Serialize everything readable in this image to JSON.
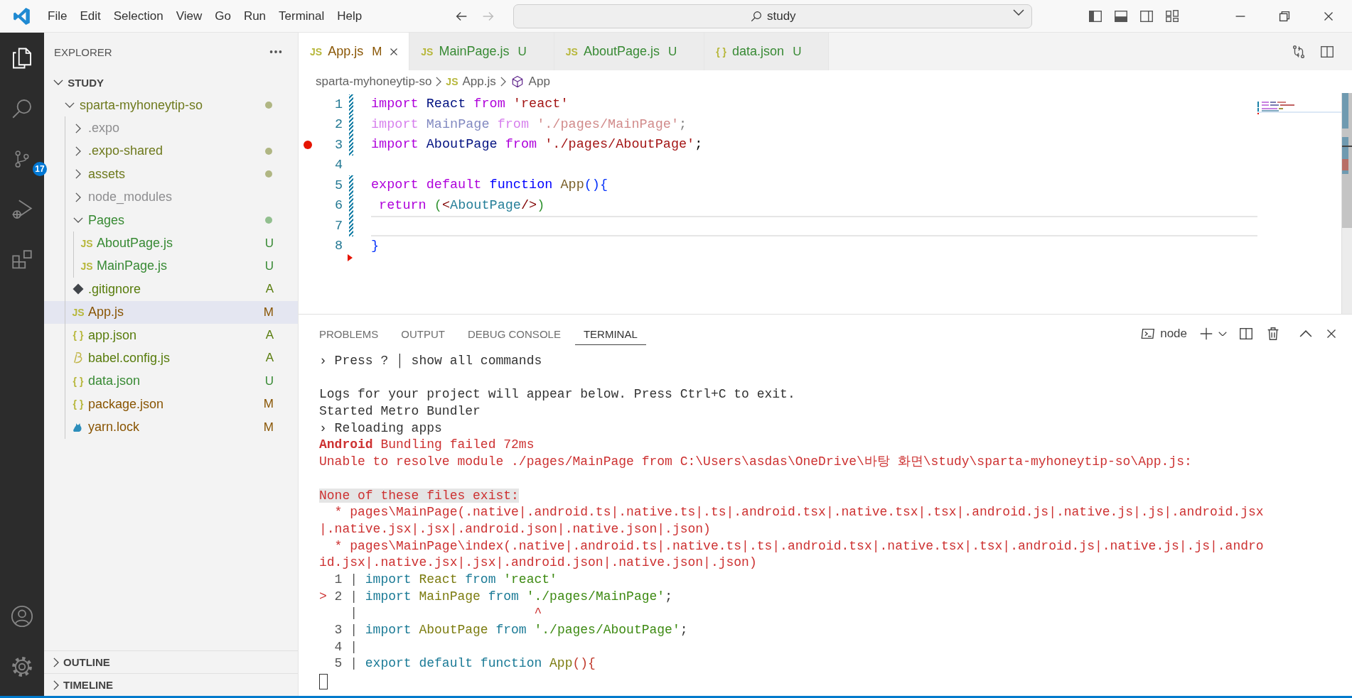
{
  "menu": [
    "File",
    "Edit",
    "Selection",
    "View",
    "Go",
    "Run",
    "Terminal",
    "Help"
  ],
  "search": {
    "value": "study"
  },
  "activity_bar": [
    {
      "kind": "explorer",
      "selected": true
    },
    {
      "kind": "search",
      "selected": false
    },
    {
      "kind": "source-control",
      "selected": false,
      "badge": "17"
    },
    {
      "kind": "run-debug",
      "selected": false
    },
    {
      "kind": "extensions",
      "selected": false
    }
  ],
  "activity_bottom": [
    {
      "kind": "account"
    },
    {
      "kind": "settings"
    }
  ],
  "sidebar": {
    "title": "EXPLORER",
    "root": {
      "label": "STUDY",
      "expanded": true
    },
    "tree": [
      {
        "label": "sparta-myhoneytip-so",
        "kind": "folder",
        "color": "#6f7a1e",
        "dot": true,
        "expanded": true,
        "selected": false,
        "children": [
          {
            "label": ".expo",
            "kind": "folder",
            "color": "#8e8e90",
            "dot": false,
            "expanded": false,
            "selected": false
          },
          {
            "label": ".expo-shared",
            "kind": "folder",
            "color": "#6f7a1e",
            "dot": true,
            "expanded": false,
            "selected": false
          },
          {
            "label": "assets",
            "kind": "folder",
            "color": "#6f7a1e",
            "dot": true,
            "expanded": false,
            "selected": false
          },
          {
            "label": "node_modules",
            "kind": "folder",
            "color": "#8e8e90",
            "dot": false,
            "expanded": false,
            "selected": false
          },
          {
            "label": "Pages",
            "kind": "folder",
            "color": "#388a34",
            "dot": true,
            "expanded": true,
            "selected": false,
            "children": [
              {
                "label": "AboutPage.js",
                "kind": "file",
                "icon": {
                  "kind": "text",
                  "text": "JS"
                },
                "color": "#388a34",
                "status": "U",
                "selected": false
              },
              {
                "label": "MainPage.js",
                "kind": "file",
                "icon": {
                  "kind": "text",
                  "text": "JS"
                },
                "color": "#388a34",
                "status": "U",
                "selected": false
              }
            ]
          },
          {
            "label": ".gitignore",
            "kind": "file",
            "icon": {
              "kind": "git"
            },
            "color": "#587c0c",
            "status": "A",
            "selected": false
          },
          {
            "label": "App.js",
            "kind": "file",
            "icon": {
              "kind": "text",
              "text": "JS"
            },
            "color": "#895503",
            "status": "M",
            "selected": true
          },
          {
            "label": "app.json",
            "kind": "file",
            "icon": {
              "kind": "text",
              "text": "{ }"
            },
            "color": "#587c0c",
            "status": "A",
            "selected": false
          },
          {
            "label": "babel.config.js",
            "kind": "file",
            "icon": {
              "kind": "babel"
            },
            "color": "#587c0c",
            "status": "A",
            "selected": false
          },
          {
            "label": "data.json",
            "kind": "file",
            "icon": {
              "kind": "text",
              "text": "{ }"
            },
            "color": "#388a34",
            "status": "U",
            "selected": false
          },
          {
            "label": "package.json",
            "kind": "file",
            "icon": {
              "kind": "text",
              "text": "{ }"
            },
            "color": "#895503",
            "status": "M",
            "selected": false
          },
          {
            "label": "yarn.lock",
            "kind": "file",
            "icon": {
              "kind": "yarn"
            },
            "color": "#895503",
            "status": "M",
            "selected": false
          }
        ]
      }
    ],
    "sections": [
      {
        "label": "OUTLINE",
        "expanded": false
      },
      {
        "label": "TIMELINE",
        "expanded": false
      }
    ]
  },
  "tabs": [
    {
      "label": "App.js",
      "icon": {
        "kind": "text",
        "text": "JS"
      },
      "status": "M",
      "color": "#895503",
      "selected": true
    },
    {
      "label": "MainPage.js",
      "icon": {
        "kind": "text",
        "text": "JS"
      },
      "status": "U",
      "color": "#388a34",
      "selected": false
    },
    {
      "label": "AboutPage.js",
      "icon": {
        "kind": "text",
        "text": "JS"
      },
      "status": "U",
      "color": "#388a34",
      "selected": false
    },
    {
      "label": "data.json",
      "icon": {
        "kind": "text",
        "text": "{ }"
      },
      "status": "U",
      "color": "#388a34",
      "selected": false
    }
  ],
  "breadcrumb": [
    {
      "label": "sparta-myhoneytip-so"
    },
    {
      "label": "App.js",
      "icon": {
        "kind": "text",
        "text": "JS"
      }
    },
    {
      "label": "App",
      "icon": {
        "kind": "symbol"
      }
    }
  ],
  "editor": {
    "lines": [
      {
        "number": "1",
        "changed": true,
        "deleted": false,
        "breakpoint": false,
        "current": false,
        "faded": false,
        "tokens": [
          {
            "t": "import ",
            "kind": "keyword"
          },
          {
            "t": "React ",
            "kind": "variable"
          },
          {
            "t": "from ",
            "kind": "keyword"
          },
          {
            "t": "'react'",
            "kind": "string"
          }
        ]
      },
      {
        "number": "2",
        "changed": true,
        "deleted": false,
        "breakpoint": false,
        "current": false,
        "faded": true,
        "tokens": [
          {
            "t": "import ",
            "kind": "keyword"
          },
          {
            "t": "MainPage ",
            "kind": "variable"
          },
          {
            "t": "from ",
            "kind": "keyword"
          },
          {
            "t": "'./pages/MainPage'",
            "kind": "string"
          },
          {
            "t": ";",
            "kind": "punct"
          }
        ]
      },
      {
        "number": "3",
        "changed": true,
        "deleted": false,
        "breakpoint": true,
        "current": false,
        "faded": false,
        "tokens": [
          {
            "t": "import ",
            "kind": "keyword"
          },
          {
            "t": "AboutPage ",
            "kind": "variable"
          },
          {
            "t": "from ",
            "kind": "keyword"
          },
          {
            "t": "'./pages/AboutPage'",
            "kind": "string"
          },
          {
            "t": ";",
            "kind": "punct"
          }
        ]
      },
      {
        "number": "4",
        "changed": false,
        "deleted": false,
        "breakpoint": false,
        "current": false
      },
      {
        "number": "5",
        "changed": true,
        "deleted": false,
        "breakpoint": false,
        "current": false,
        "faded": false,
        "tokens": [
          {
            "t": "export default ",
            "kind": "keyword"
          },
          {
            "t": "function ",
            "kind": "storage"
          },
          {
            "t": "App",
            "kind": "function"
          },
          {
            "t": "(){",
            "kind": "brace"
          }
        ]
      },
      {
        "number": "6",
        "changed": true,
        "deleted": false,
        "breakpoint": false,
        "current": false,
        "faded": false,
        "tokens": [
          {
            "t": " return ",
            "kind": "keyword"
          },
          {
            "t": "(",
            "kind": "paren"
          },
          {
            "t": "<",
            "kind": "tagpunct"
          },
          {
            "t": "AboutPage",
            "kind": "tag"
          },
          {
            "t": "/>",
            "kind": "tagpunct"
          },
          {
            "t": ")",
            "kind": "paren"
          }
        ]
      },
      {
        "number": "7",
        "changed": true,
        "deleted": false,
        "breakpoint": false,
        "current": true
      },
      {
        "number": "8",
        "changed": false,
        "deleted": true,
        "breakpoint": false,
        "current": false,
        "faded": false,
        "tokens": [
          {
            "t": "}",
            "kind": "brace"
          }
        ]
      }
    ]
  },
  "panel": {
    "tabs": [
      {
        "label": "PROBLEMS",
        "selected": false
      },
      {
        "label": "OUTPUT",
        "selected": false
      },
      {
        "label": "DEBUG CONSOLE",
        "selected": false
      },
      {
        "label": "TERMINAL",
        "selected": true
      }
    ],
    "terminal_name": "node",
    "lines": [
      {
        "kind": "text",
        "segments": [
          {
            "t": "› Press ? │ show all commands",
            "kind": "plain"
          }
        ]
      },
      {
        "kind": "blank"
      },
      {
        "kind": "text",
        "segments": [
          {
            "t": "Logs for your project will appear below. Press Ctrl+C to exit.",
            "kind": "plain"
          }
        ]
      },
      {
        "kind": "text",
        "segments": [
          {
            "t": "Started Metro Bundler",
            "kind": "plain"
          }
        ]
      },
      {
        "kind": "text",
        "segments": [
          {
            "t": "› Reloading apps",
            "kind": "plain"
          }
        ]
      },
      {
        "kind": "text",
        "segments": [
          {
            "t": "Android",
            "kind": "errorbold"
          },
          {
            "t": " Bundling failed 72ms",
            "kind": "error"
          }
        ]
      },
      {
        "kind": "text",
        "segments": [
          {
            "t": "Unable to resolve module ./pages/MainPage from C:\\Users\\asdas\\OneDrive\\바탕 화면\\study\\sparta-myhoneytip-so\\App.js:",
            "kind": "error"
          }
        ]
      },
      {
        "kind": "blank"
      },
      {
        "kind": "text",
        "segments": [
          {
            "t": "None of these files exist:",
            "kind": "errorhighlight"
          }
        ]
      },
      {
        "kind": "text",
        "segments": [
          {
            "t": "  * pages\\MainPage(.native|.android.ts|.native.ts|.ts|.android.tsx|.native.tsx|.tsx|.android.js|.native.js|.js|.android.jsx",
            "kind": "error"
          }
        ]
      },
      {
        "kind": "text",
        "segments": [
          {
            "t": "|.native.jsx|.jsx|.android.json|.native.json|.json)",
            "kind": "error"
          }
        ]
      },
      {
        "kind": "text",
        "segments": [
          {
            "t": "  * pages\\MainPage\\index(.native|.android.ts|.native.ts|.ts|.android.tsx|.native.tsx|.tsx|.android.js|.native.js|.js|.andro",
            "kind": "error"
          }
        ]
      },
      {
        "kind": "text",
        "segments": [
          {
            "t": "id.jsx|.native.jsx|.jsx|.android.json|.native.json|.json)",
            "kind": "error"
          }
        ]
      },
      {
        "kind": "text",
        "segments": [
          {
            "t": "  1 | ",
            "kind": "gutter"
          },
          {
            "t": "import ",
            "kind": "keyword"
          },
          {
            "t": "React ",
            "kind": "identifier"
          },
          {
            "t": "from ",
            "kind": "keyword"
          },
          {
            "t": "'react'",
            "kind": "string"
          }
        ]
      },
      {
        "kind": "text",
        "segments": [
          {
            "t": "> ",
            "kind": "marker"
          },
          {
            "t": "2 | ",
            "kind": "gutter"
          },
          {
            "t": "import ",
            "kind": "keyword"
          },
          {
            "t": "MainPage ",
            "kind": "identifier"
          },
          {
            "t": "from ",
            "kind": "keyword"
          },
          {
            "t": "'./pages/MainPage'",
            "kind": "string"
          },
          {
            "t": ";",
            "kind": "plain"
          }
        ]
      },
      {
        "kind": "text",
        "segments": [
          {
            "t": "    | ",
            "kind": "gutter"
          },
          {
            "t": "                      ^",
            "kind": "marker"
          }
        ]
      },
      {
        "kind": "text",
        "segments": [
          {
            "t": "  3 | ",
            "kind": "gutter"
          },
          {
            "t": "import ",
            "kind": "keyword"
          },
          {
            "t": "AboutPage ",
            "kind": "identifier"
          },
          {
            "t": "from ",
            "kind": "keyword"
          },
          {
            "t": "'./pages/AboutPage'",
            "kind": "string"
          },
          {
            "t": ";",
            "kind": "plain"
          }
        ]
      },
      {
        "kind": "text",
        "segments": [
          {
            "t": "  4 |",
            "kind": "gutter"
          }
        ]
      },
      {
        "kind": "text",
        "segments": [
          {
            "t": "  5 | ",
            "kind": "gutter"
          },
          {
            "t": "export default function ",
            "kind": "keyword"
          },
          {
            "t": "App",
            "kind": "identifier"
          },
          {
            "t": "(){",
            "kind": "brace"
          }
        ]
      },
      {
        "kind": "cursor"
      }
    ]
  }
}
